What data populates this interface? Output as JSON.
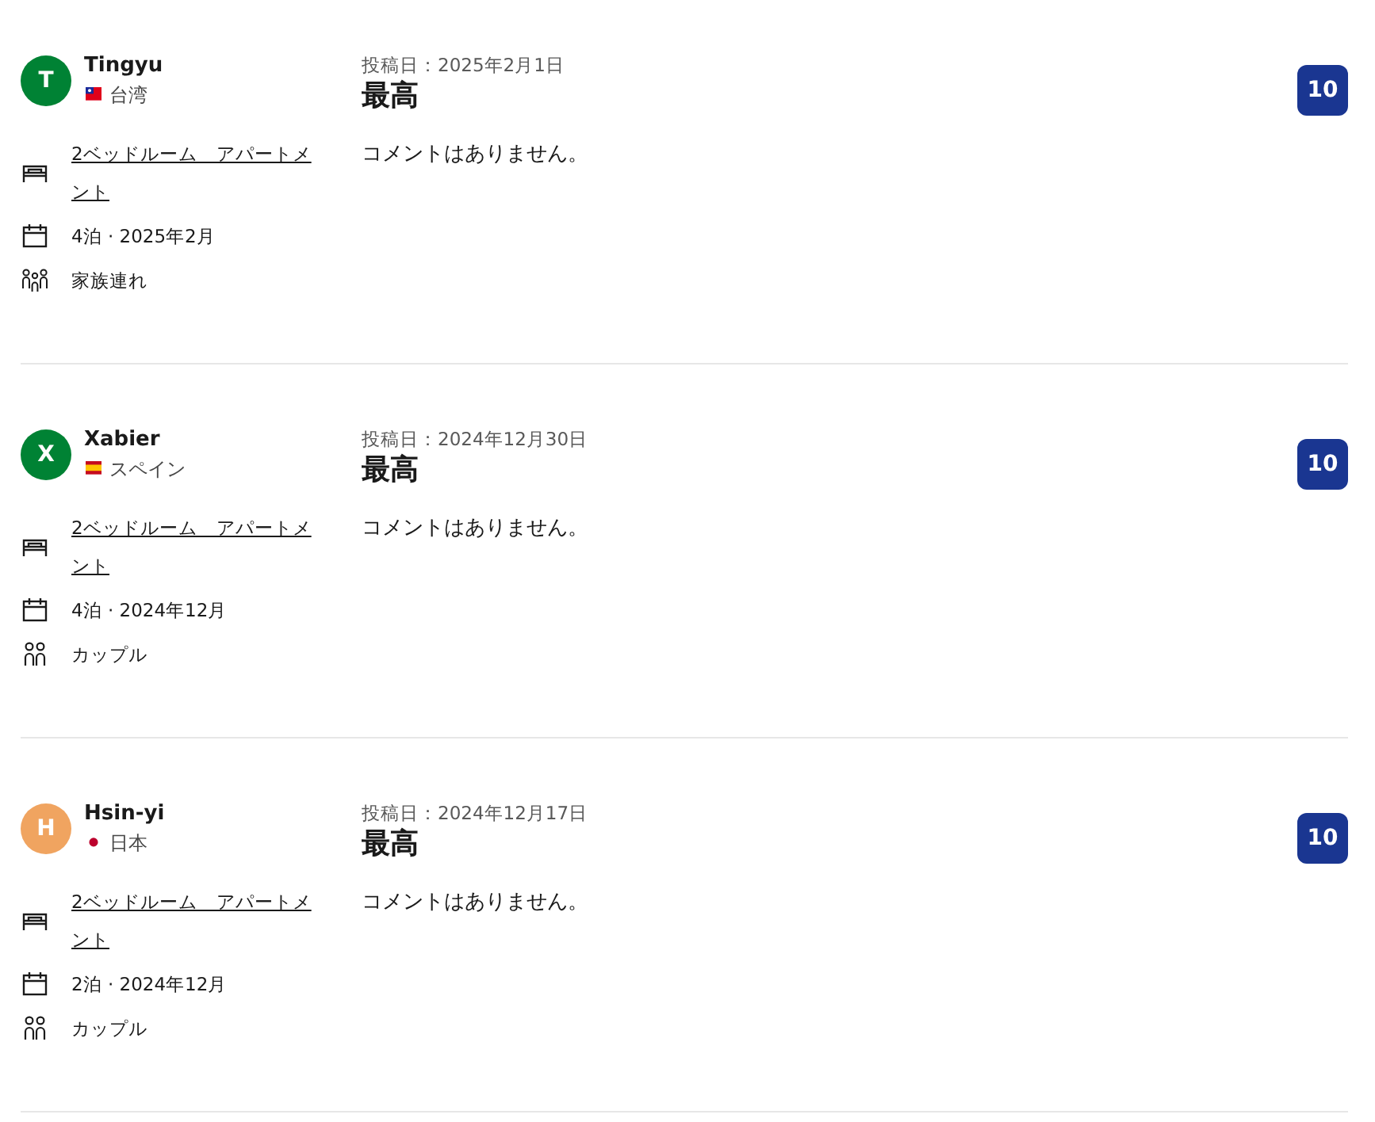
{
  "reviews": [
    {
      "avatar": {
        "initial": "T",
        "color": "#008234"
      },
      "name": "Tingyu",
      "country": {
        "kind": "taiwan",
        "name": "台湾"
      },
      "details": [
        {
          "kind": "room",
          "text": "2ベッドルーム　アパートメント"
        },
        {
          "kind": "stay",
          "text": "4泊 · 2025年2月"
        },
        {
          "kind": "family",
          "text": "家族連れ"
        }
      ],
      "date": "投稿日：2025年2月1日",
      "title": "最高",
      "comment": "コメントはありません。",
      "score": "10"
    },
    {
      "avatar": {
        "initial": "X",
        "color": "#008234"
      },
      "name": "Xabier",
      "country": {
        "kind": "spain",
        "name": "スペイン"
      },
      "details": [
        {
          "kind": "room",
          "text": "2ベッドルーム　アパートメント"
        },
        {
          "kind": "stay",
          "text": "4泊 · 2024年12月"
        },
        {
          "kind": "couple",
          "text": "カップル"
        }
      ],
      "date": "投稿日：2024年12月30日",
      "title": "最高",
      "comment": "コメントはありません。",
      "score": "10"
    },
    {
      "avatar": {
        "initial": "H",
        "color": "#f0a460"
      },
      "name": "Hsin-yi",
      "country": {
        "kind": "japan",
        "name": "日本"
      },
      "details": [
        {
          "kind": "room",
          "text": "2ベッドルーム　アパートメント"
        },
        {
          "kind": "stay",
          "text": "2泊 · 2024年12月"
        },
        {
          "kind": "couple",
          "text": "カップル"
        }
      ],
      "date": "投稿日：2024年12月17日",
      "title": "最高",
      "comment": "コメントはありません。",
      "score": "10"
    }
  ]
}
